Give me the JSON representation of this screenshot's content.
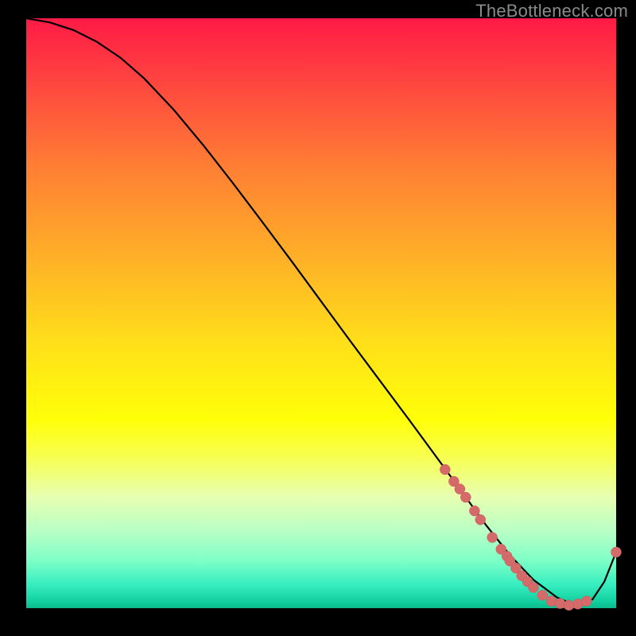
{
  "watermark": "TheBottleneck.com",
  "colors": {
    "curve_stroke": "#000000",
    "dot_fill": "#d56a6a",
    "dot_stroke": "#c75a5a",
    "gradient_top": "#ff1a46",
    "gradient_bottom": "#0db88c"
  },
  "chart_data": {
    "type": "line",
    "title": "",
    "xlabel": "",
    "ylabel": "",
    "xlim": [
      0,
      100
    ],
    "ylim": [
      0,
      100
    ],
    "series": [
      {
        "name": "bottleneck-curve",
        "x": [
          0,
          4,
          8,
          12,
          16,
          20,
          25,
          30,
          35,
          40,
          45,
          50,
          55,
          60,
          65,
          70,
          74,
          78,
          82,
          86,
          90,
          93,
          96,
          98,
          100
        ],
        "y": [
          100,
          99.3,
          98.0,
          96.0,
          93.3,
          89.8,
          84.5,
          78.5,
          72.1,
          65.5,
          58.8,
          52.0,
          45.2,
          38.5,
          31.8,
          25.0,
          19.5,
          14.0,
          9.0,
          4.8,
          1.8,
          0.5,
          1.5,
          4.5,
          9.5
        ]
      }
    ],
    "dots": [
      {
        "x": 71.0,
        "y": 23.5
      },
      {
        "x": 72.5,
        "y": 21.5
      },
      {
        "x": 73.5,
        "y": 20.2
      },
      {
        "x": 74.5,
        "y": 18.8
      },
      {
        "x": 76.0,
        "y": 16.5
      },
      {
        "x": 77.0,
        "y": 15.0
      },
      {
        "x": 79.0,
        "y": 12.0
      },
      {
        "x": 80.5,
        "y": 10.0
      },
      {
        "x": 81.5,
        "y": 8.8
      },
      {
        "x": 82.0,
        "y": 8.0
      },
      {
        "x": 83.0,
        "y": 6.8
      },
      {
        "x": 84.0,
        "y": 5.5
      },
      {
        "x": 85.0,
        "y": 4.5
      },
      {
        "x": 86.0,
        "y": 3.5
      },
      {
        "x": 87.5,
        "y": 2.2
      },
      {
        "x": 89.0,
        "y": 1.2
      },
      {
        "x": 90.5,
        "y": 0.8
      },
      {
        "x": 92.0,
        "y": 0.5
      },
      {
        "x": 93.5,
        "y": 0.7
      },
      {
        "x": 95.0,
        "y": 1.2
      },
      {
        "x": 100.0,
        "y": 9.5
      }
    ]
  }
}
